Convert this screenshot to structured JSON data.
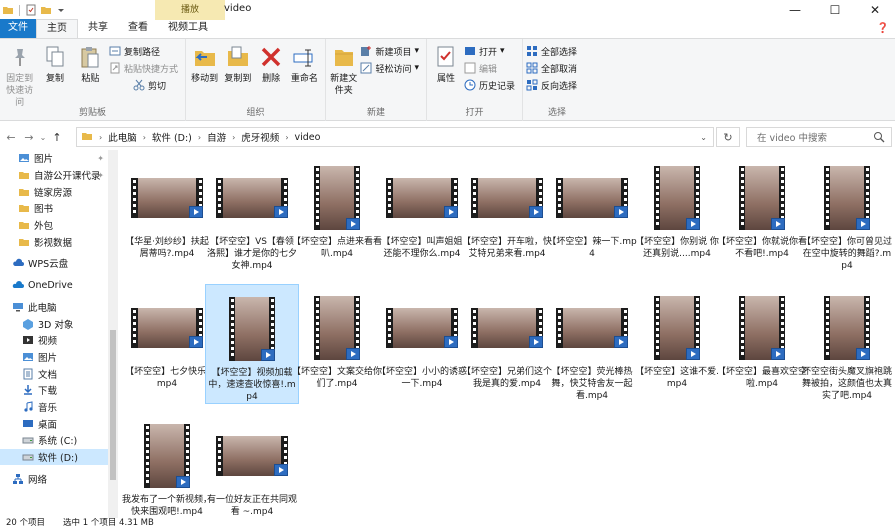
{
  "window": {
    "title": "video",
    "context_tab": "播放",
    "buttons": [
      "minimize",
      "maximize",
      "close"
    ]
  },
  "ribbon": {
    "tabs": [
      "文件",
      "主页",
      "共享",
      "查看",
      "视频工具"
    ],
    "active_tab": "主页",
    "clipboard": {
      "label": "剪贴板",
      "pin_label": "固定到快速访问",
      "copy_label": "复制",
      "paste_label": "粘贴",
      "copy_path": "复制路径",
      "paste_shortcut": "粘贴快捷方式",
      "cut": "剪切"
    },
    "organize": {
      "label": "组织",
      "move_to": "移动到",
      "copy_to": "复制到",
      "delete": "删除",
      "rename": "重命名"
    },
    "new": {
      "label": "新建",
      "new_folder": "新建文件夹",
      "new_item": "新建项目",
      "easy_access": "轻松访问"
    },
    "open": {
      "label": "打开",
      "properties": "属性",
      "open": "打开",
      "edit": "编辑",
      "history": "历史记录"
    },
    "select": {
      "label": "选择",
      "select_all": "全部选择",
      "select_none": "全部取消",
      "invert": "反向选择"
    }
  },
  "address": {
    "crumbs": [
      "此电脑",
      "软件 (D:)",
      "自游",
      "虎牙视频",
      "video"
    ],
    "search_placeholder": "在 video 中搜索"
  },
  "nav_pane": {
    "items": [
      {
        "label": "图片",
        "icon": "pictures-icon",
        "pinned": true
      },
      {
        "label": "自游公开课代录",
        "icon": "folder-icon",
        "pinned": true
      },
      {
        "label": "链家房源",
        "icon": "folder-icon",
        "pinned": false
      },
      {
        "label": "图书",
        "icon": "folder-icon",
        "pinned": false
      },
      {
        "label": "外包",
        "icon": "folder-icon",
        "pinned": false
      },
      {
        "label": "影视数据",
        "icon": "folder-icon",
        "pinned": false
      },
      {
        "label": "WPS云盘",
        "icon": "cloud-icon",
        "pinned": false
      },
      {
        "label": "OneDrive",
        "icon": "onedrive-icon",
        "pinned": false
      },
      {
        "label": "此电脑",
        "icon": "computer-icon",
        "pinned": false
      },
      {
        "label": "3D 对象",
        "icon": "objects-3d-icon",
        "pinned": false
      },
      {
        "label": "视频",
        "icon": "videos-icon",
        "pinned": false
      },
      {
        "label": "图片",
        "icon": "pictures-icon",
        "pinned": false
      },
      {
        "label": "文档",
        "icon": "documents-icon",
        "pinned": false
      },
      {
        "label": "下载",
        "icon": "downloads-icon",
        "pinned": false
      },
      {
        "label": "音乐",
        "icon": "music-icon",
        "pinned": false
      },
      {
        "label": "桌面",
        "icon": "desktop-icon",
        "pinned": false
      },
      {
        "label": "系统 (C:)",
        "icon": "drive-icon",
        "pinned": false
      },
      {
        "label": "软件 (D:)",
        "icon": "drive-icon",
        "pinned": false
      },
      {
        "label": "网络",
        "icon": "network-icon",
        "pinned": false
      }
    ],
    "selected_index": 17
  },
  "files": [
    {
      "name": "【华星·刘纱纱】扶起屑蒂吗?.mp4",
      "kind": "wide"
    },
    {
      "name": "【坏空空】VS【春领洛熙】谁才是你的七夕女神.mp4",
      "kind": "wide"
    },
    {
      "name": "【坏空空】点进来看看叭.mp4",
      "kind": "tall"
    },
    {
      "name": "【坏空空】叫声姐姐 还能不理你么.mp4",
      "kind": "wide"
    },
    {
      "name": "【坏空空】开车啦，快艾特兄弟来看.mp4",
      "kind": "wide"
    },
    {
      "name": "【坏空空】辣一下.mp4",
      "kind": "wide"
    },
    {
      "name": "【坏空空】你别说 你还真别说....mp4",
      "kind": "tall"
    },
    {
      "name": "【坏空空】你就说你看不看吧!.mp4",
      "kind": "tall"
    },
    {
      "name": "【坏空空】你可曾见过在空中旋转的舞蹈?.mp4",
      "kind": "tall"
    },
    {
      "name": "【坏空空】七夕快乐.mp4",
      "kind": "wide"
    },
    {
      "name": "【坏空空】视频加载中，速速查收惊喜!.mp4",
      "kind": "tall"
    },
    {
      "name": "【坏空空】文案交给你们了.mp4",
      "kind": "tall"
    },
    {
      "name": "【坏空空】小小的诱惑一下.mp4",
      "kind": "wide"
    },
    {
      "name": "【坏空空】兄弟们这个我是真的爱.mp4",
      "kind": "wide"
    },
    {
      "name": "【坏空空】荧光棒热舞，快艾特舍友一起看.mp4",
      "kind": "wide"
    },
    {
      "name": "【坏空空】这谁不爱.mp4",
      "kind": "tall"
    },
    {
      "name": "【坏空空】最喜欢空空啦.mp4",
      "kind": "tall"
    },
    {
      "name": "坏空空街头魔叉旗袍跳舞被拍，这颜值也太真实了吧.mp4",
      "kind": "tall"
    },
    {
      "name": "我发布了一个新视频，快来围观吧!.mp4",
      "kind": "tall"
    },
    {
      "name": "有一位好友正在共同观看 ~.mp4",
      "kind": "wide"
    }
  ],
  "selected_file_index": 10,
  "status": {
    "count": "20 个项目",
    "selection": "选中 1 个项目  4.31 MB"
  },
  "colors": {
    "accent": "#1979ca",
    "selection": "#cce8ff",
    "selection_border": "#99d1ff",
    "context_tab": "#f6e9b2"
  }
}
